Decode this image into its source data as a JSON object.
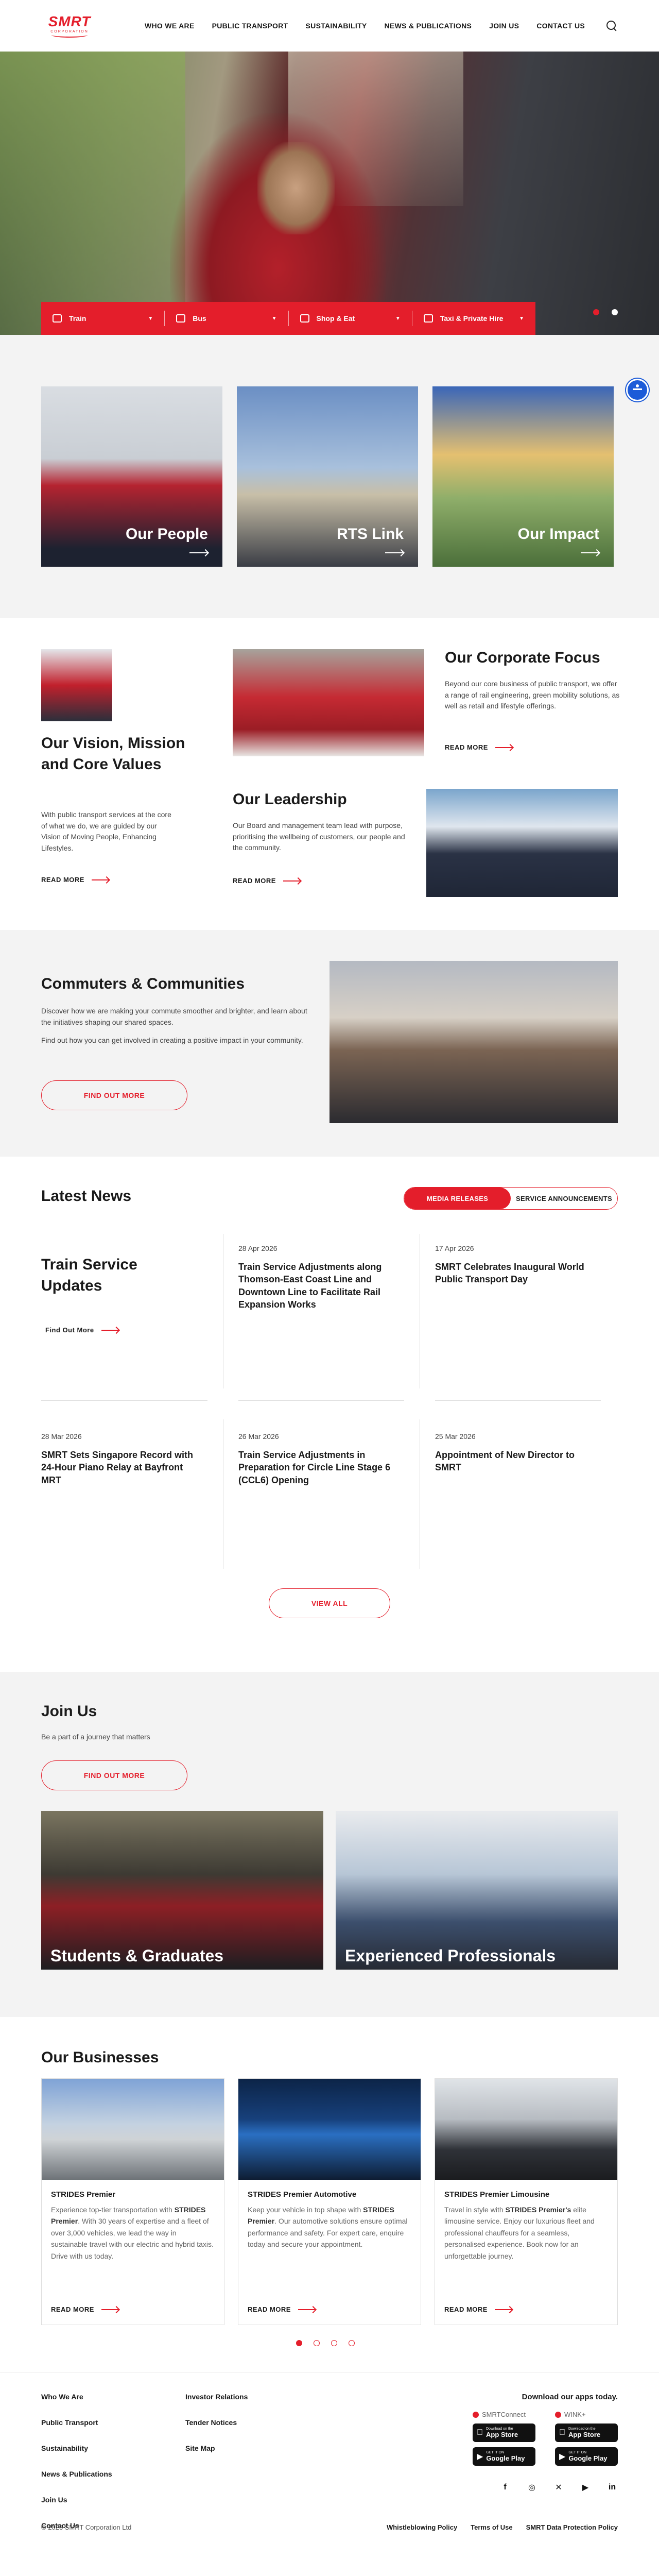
{
  "header": {
    "logo_text": "SMRT",
    "logo_sub": "CORPORATION",
    "nav": [
      "WHO WE ARE",
      "PUBLIC TRANSPORT",
      "SUSTAINABILITY",
      "NEWS & PUBLICATIONS",
      "JOIN US",
      "CONTACT US"
    ]
  },
  "hero": {
    "menu": [
      "Train",
      "Bus",
      "Shop & Eat",
      "Taxi & Private Hire"
    ],
    "slides": 2,
    "active_slide": 1
  },
  "tiles": [
    "Our People",
    "RTS Link",
    "Our Impact"
  ],
  "about": {
    "vision_title": "Our Vision, Mission and Core Values",
    "vision_text": "With public transport services at the core of what we do, we are guided by our Vision of Moving People, Enhancing Lifestyles.",
    "corporate_title": "Our Corporate Focus",
    "corporate_text": "Beyond our core business of public transport, we offer a range of rail engineering, green mobility solutions, as well as retail and lifestyle offerings.",
    "leadership_title": "Our Leadership",
    "leadership_text": "Our Board and management team lead with purpose, prioritising the wellbeing of customers, our people and the community.",
    "read_more": "READ MORE"
  },
  "commuters": {
    "title": "Commuters & Communities",
    "p1": "Discover how we are making your commute smoother and brighter, and learn about the initiatives shaping our shared spaces.",
    "p2": "Find out how you can get involved in creating a positive impact in your community.",
    "button": "FIND OUT MORE"
  },
  "news": {
    "title": "Latest News",
    "tabs": [
      "MEDIA RELEASES",
      "SERVICE ANNOUNCEMENTS"
    ],
    "featured_title": "Train Service Updates",
    "featured_link": "Find Out More",
    "items": [
      {
        "date": "28 Apr 2026",
        "title": "Train Service Adjustments along Thomson-East Coast Line and Downtown Line to Facilitate Rail Expansion Works"
      },
      {
        "date": "17 Apr 2026",
        "title": "SMRT Celebrates Inaugural World Public Transport Day"
      },
      {
        "date": "28 Mar 2026",
        "title": "SMRT Sets Singapore Record with 24-Hour Piano Relay at Bayfront MRT"
      },
      {
        "date": "26 Mar 2026",
        "title": "Train Service Adjustments in Preparation for Circle Line Stage 6 (CCL6) Opening"
      },
      {
        "date": "25 Mar 2026",
        "title": "Appointment of New Director to SMRT"
      }
    ],
    "view_all": "VIEW ALL"
  },
  "join": {
    "title": "Join Us",
    "subtitle": "Be a part of a journey that matters",
    "button": "FIND OUT MORE",
    "cards": [
      "Students & Graduates",
      "Experienced Professionals"
    ]
  },
  "businesses": {
    "title": "Our Businesses",
    "cards": [
      {
        "name": "STRIDES Premier",
        "pre": "Experience top-tier transportation with ",
        "bold": "STRIDES Premier",
        "post": ". With 30 years of expertise and a fleet of over 3,000 vehicles, we lead the way in sustainable travel with our electric and hybrid taxis. Drive with us today."
      },
      {
        "name": "STRIDES Premier Automotive",
        "pre": "Keep your vehicle in top shape with ",
        "bold": "STRIDES Premier",
        "post": ". Our automotive solutions ensure optimal performance and safety. For expert care, enquire today and secure your appointment."
      },
      {
        "name": "STRIDES Premier Limousine",
        "pre": "Travel in style with ",
        "bold": "STRIDES Premier's",
        "post": " elite limousine service. Enjoy our luxurious fleet and professional chauffeurs for a seamless, personalised experience. Book now for an unforgettable journey."
      }
    ],
    "read_more": "READ MORE",
    "pages": 4,
    "active_page": 1
  },
  "footer": {
    "col1": [
      "Who We Are",
      "Public Transport",
      "Sustainability",
      "News & Publications",
      "Join Us",
      "Contact Us"
    ],
    "col2": [
      "Investor Relations",
      "Tender Notices",
      "Site Map"
    ],
    "download_title": "Download our apps today.",
    "apps": [
      "SMRTConnect",
      "WINK+"
    ],
    "app_store_small": "Download on the",
    "app_store": "App Store",
    "play_small": "GET IT ON",
    "play": "Google Play",
    "social": [
      "facebook-icon",
      "instagram-icon",
      "x-icon",
      "youtube-icon",
      "linkedin-icon"
    ],
    "copyright": "© 2026 SMRT Corporation Ltd",
    "legal": [
      "Whistleblowing Policy",
      "Terms of Use",
      "SMRT Data Protection Policy"
    ]
  },
  "colors": {
    "brand": "#e41e2b",
    "accessibility": "#1c5bd8"
  }
}
